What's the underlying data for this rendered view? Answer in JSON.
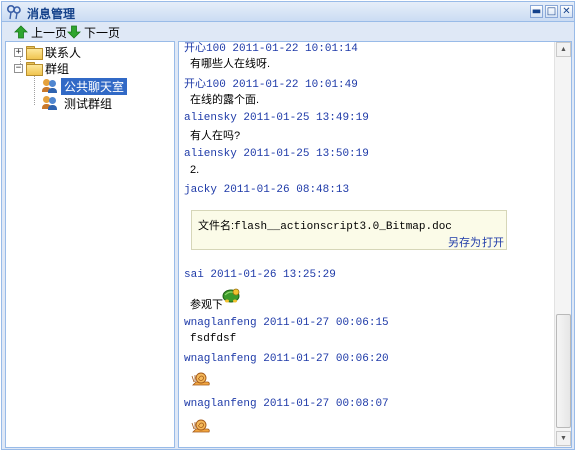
{
  "window": {
    "title": "消息管理",
    "minimize_symbol": "▬",
    "maximize_symbol": "□",
    "close_symbol": "✕"
  },
  "toolbar": {
    "prev_label": "上一页",
    "next_label": "下一页"
  },
  "tree": {
    "contacts_label": "联系人",
    "groups_label": "群组",
    "contacts_expander": "+",
    "groups_expander": "−",
    "items": [
      {
        "label": "公共聊天室",
        "selected": true
      },
      {
        "label": "测试群组",
        "selected": false
      }
    ]
  },
  "messages": [
    {
      "sender": "开心100",
      "time": "2011-01-22 10:01:14",
      "text": "有哪些人在线呀."
    },
    {
      "sender": "开心100",
      "time": "2011-01-22 10:01:49",
      "text": "在线的露个面."
    },
    {
      "sender": "aliensky",
      "time": "2011-01-25 13:49:19",
      "text": "有人在吗?"
    },
    {
      "sender": "aliensky",
      "time": "2011-01-25 13:50:19",
      "text": "2."
    },
    {
      "sender": "jacky",
      "time": "2011-01-26 08:48:13",
      "text": ""
    },
    {
      "sender": "sai",
      "time": "2011-01-26 13:25:29",
      "text": "参观下"
    },
    {
      "sender": "wnaglanfeng",
      "time": "2011-01-27 00:06:15",
      "text": "fsdfdsf"
    },
    {
      "sender": "wnaglanfeng",
      "time": "2011-01-27 00:06:20",
      "text": ""
    },
    {
      "sender": "wnaglanfeng",
      "time": "2011-01-27 00:08:07",
      "text": ""
    }
  ],
  "file_attachment": {
    "prefix": "文件名:",
    "filename": "flash__actionscript3.0_Bitmap.doc",
    "save_as": "另存为",
    "open": "打开"
  },
  "icons": {
    "emoticon_turtle": "turtle-emoticon-icon",
    "emoticon_snail": "snail-emoticon-icon"
  },
  "colors": {
    "sender_text": "#1e3aa8",
    "selection": "#3169c6",
    "border": "#99bbe8",
    "window_bg": "#dfe8f6"
  }
}
